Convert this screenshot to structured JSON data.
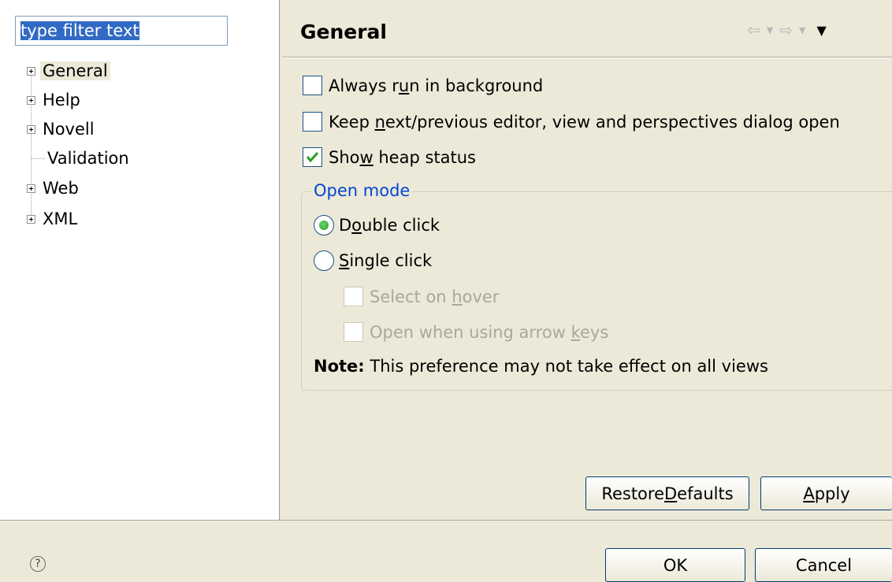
{
  "filter": {
    "value": "type filter text"
  },
  "tree": {
    "items": [
      {
        "label": "General",
        "expandable": true,
        "selected": true
      },
      {
        "label": "Help",
        "expandable": true
      },
      {
        "label": "Novell",
        "expandable": true
      },
      {
        "label": "Validation",
        "expandable": false
      },
      {
        "label": "Web",
        "expandable": true
      },
      {
        "label": "XML",
        "expandable": true
      }
    ]
  },
  "page": {
    "title": "General",
    "options": [
      {
        "pre": "Always r",
        "mn": "u",
        "post": "n in background",
        "checked": false
      },
      {
        "pre": "Keep ",
        "mn": "n",
        "post": "ext/previous editor, view and perspectives dialog open",
        "checked": false
      },
      {
        "pre": "Sho",
        "mn": "w",
        "post": " heap status",
        "checked": true
      }
    ],
    "open_mode": {
      "legend": "Open mode",
      "double_click": {
        "pre": "D",
        "mn": "o",
        "post": "uble click",
        "selected": true
      },
      "single_click": {
        "pre": "",
        "mn": "S",
        "post": "ingle click",
        "selected": false
      },
      "select_on_hover": {
        "pre": "Select on ",
        "mn": "h",
        "post": "over"
      },
      "open_arrow_keys": {
        "pre": "Open when using arrow ",
        "mn": "k",
        "post": "eys"
      },
      "note_label": "Note:",
      "note_text": "This preference may not take effect on all views"
    },
    "buttons": {
      "restore_pre": "Restore ",
      "restore_mn": "D",
      "restore_post": "efaults",
      "apply_mn": "A",
      "apply_post": "pply"
    }
  },
  "dialog": {
    "ok": "OK",
    "cancel": "Cancel",
    "help_glyph": "?"
  },
  "colors": {
    "selection": "#316ac5",
    "legend": "#0046d5",
    "background": "#ece9d8"
  }
}
